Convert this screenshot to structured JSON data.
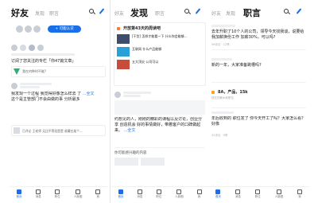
{
  "screen1": {
    "tabs": {
      "active": "好友",
      "t2": "发现",
      "t3": "职言"
    },
    "circle_btn": "+ 可能认识",
    "feed_q1": "订阅了您关注的专栏「你47篇文章」",
    "feed_q2": "我在何种时不能?",
    "post_prefix": "我发现一个过程 我觉得好像怎么样去 了",
    "post_link": "...全文",
    "post_tail": "这个是主管部门不会由做的事 分析最多",
    "post_footer": "已评论 王老师 无比平等但是是 收藏在某个...",
    "icons": [
      "home-icon",
      "chat-icon",
      "job-icon",
      "people-icon",
      "user-icon"
    ],
    "tabbar": [
      "首页",
      "消息",
      "职位",
      "人脉圈",
      "我"
    ]
  },
  "screen2": {
    "tabs": {
      "t1": "好友",
      "active": "发现",
      "t3": "职言"
    },
    "rank_title": "开放第43天的周读吧",
    "rank_items": [
      "[干货] 怎样才能看一下 什么你会能够...",
      "互联网 什么产品能够",
      "五大顶尖 公司可以"
    ],
    "mid_text": "约想见的人，刚刚的精彩的课程以及讨论，创业分享 创造机会 好的事情做好，带着客户的口碑做起来。",
    "mid_link": "...全文",
    "section_title": "你可能感兴趣的内容",
    "tabbar": [
      "首页",
      "消息",
      "职位",
      "人脉圈",
      "我"
    ]
  },
  "screen3": {
    "tabs": {
      "t1": "好友",
      "t2": "发现",
      "active": "职言"
    },
    "q1": "去年升职了10个人的公司，领导今天找我谈，说要给我加薪换份工作 加薪30%，可以吗?",
    "q1_stats": "56评论 · 12赞",
    "q2": "新的一年，大家准备跳槽吗?",
    "hashtag": "8A，产品，15k",
    "hashtag_sub": "现在的薪水和职位",
    "q3": "年后收到的 职位发了 你今天开工了吗？大家怎么看？好像",
    "q3_stats": "32评论 · 9赞",
    "tabbar": [
      "首页",
      "消息",
      "职位",
      "人脉圈",
      "我"
    ]
  }
}
